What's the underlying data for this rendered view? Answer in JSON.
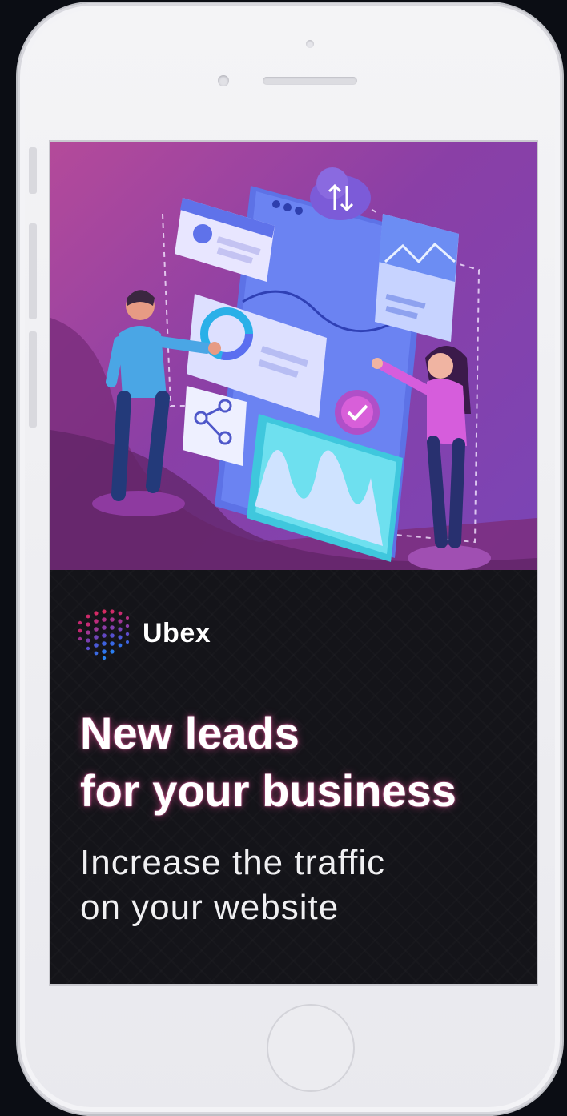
{
  "device": {
    "type": "phone-mockup",
    "color": "#f1f1f4"
  },
  "ad": {
    "brand": {
      "name": "Ubex"
    },
    "headline": {
      "line1": "New leads",
      "line2": "for your business"
    },
    "subheadline": {
      "line1": "Increase the traffic",
      "line2": "on your website"
    },
    "colors": {
      "hero_bg": "#9b44a8",
      "panel_bg": "#141419",
      "accent": "#ff4fa3"
    }
  },
  "illustration": {
    "icons": [
      "upload-download-cloud-icon",
      "donut-chart-icon",
      "share-icon",
      "checkmark-icon",
      "line-chart-icon",
      "wave-chart-icon"
    ]
  }
}
